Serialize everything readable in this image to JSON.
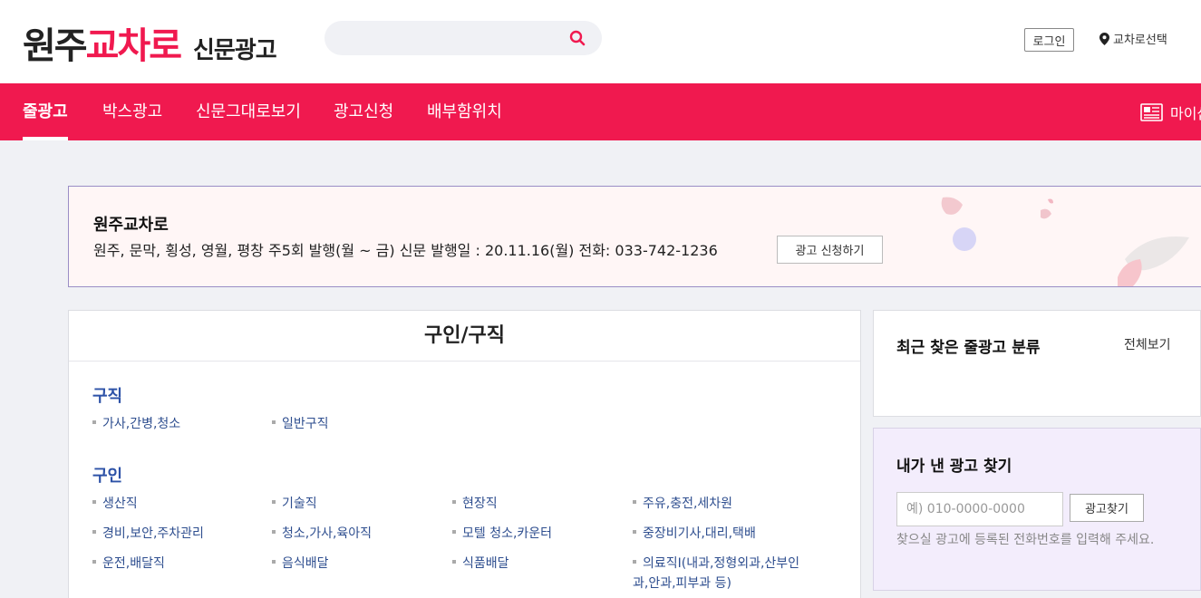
{
  "header": {
    "logo": {
      "part1": "원주",
      "part2": "교차로",
      "part3": "신문광고"
    },
    "search": {
      "placeholder": "",
      "value": ""
    },
    "login_label": "로그인",
    "region_label": "교차로선택"
  },
  "nav": {
    "items": [
      {
        "label": "줄광고",
        "active": true
      },
      {
        "label": "박스광고"
      },
      {
        "label": "신문그대로보기"
      },
      {
        "label": "광고신청"
      },
      {
        "label": "배부함위치"
      }
    ],
    "myshop_label": "마이샵"
  },
  "banner": {
    "title": "원주교차로",
    "desc": "원주, 문막, 횡성, 영월, 평창 주5회 발행(월 ~ 금) 신문 발행일 : 20.11.16(월) 전화: 033-742-1236",
    "apply_label": "광고 신청하기"
  },
  "category": {
    "title": "구인/구직",
    "sections": [
      {
        "heading": "구직",
        "items": [
          "가사,간병,청소",
          "일반구직"
        ]
      },
      {
        "heading": "구인",
        "items": [
          "생산직",
          "기술직",
          "현장직",
          "주유,충전,세차원",
          "경비,보안,주차관리",
          "청소,가사,육아직",
          "모텔 청소,카운터",
          "중장비기사,대리,택배",
          "운전,배달직",
          "음식배달",
          "식품배달",
          "의료직Ⅰ(내과,정형외과,산부인과,안과,피부과 등)"
        ]
      }
    ]
  },
  "recent": {
    "title": "최근 찾은 줄광고 분류",
    "view_all": "전체보기"
  },
  "myad": {
    "title": "내가 낸 광고 찾기",
    "placeholder": "예) 010-0000-0000",
    "find_label": "광고찾기",
    "help": "찾으실 광고에 등록된 전화번호를 입력해 주세요."
  },
  "colors": {
    "brand": "#f0194f",
    "link": "#2e4e8f",
    "section": "#2d52a7"
  }
}
